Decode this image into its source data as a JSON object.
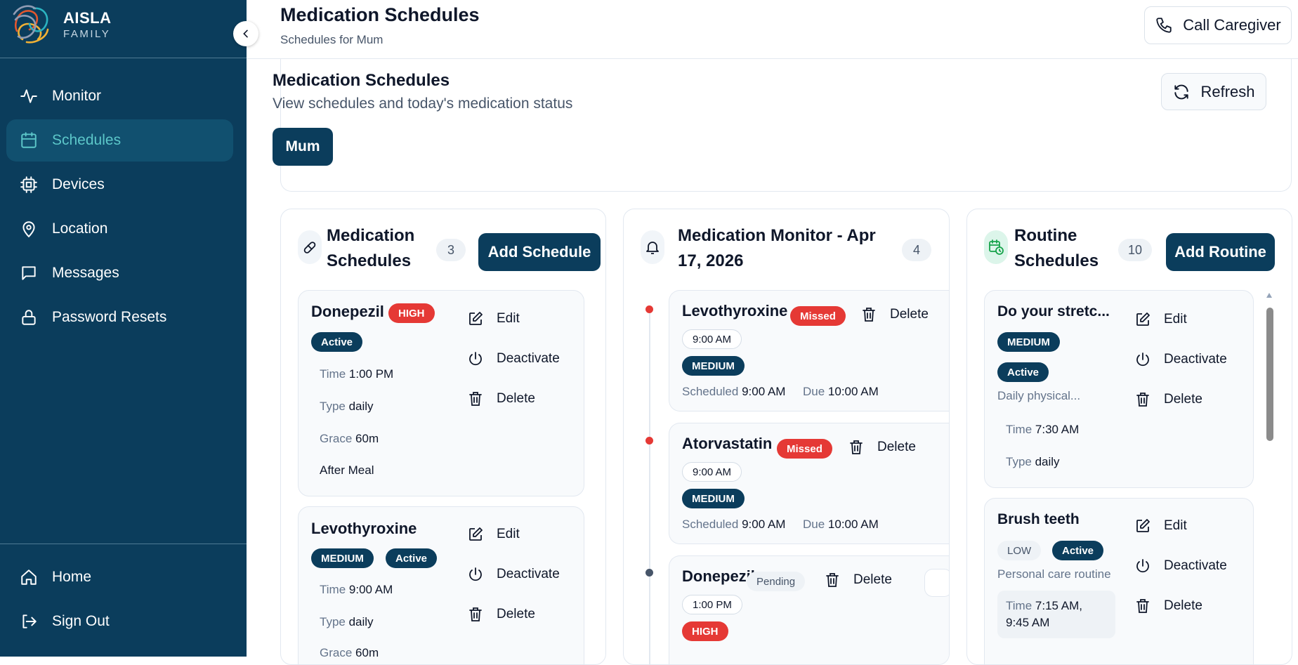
{
  "brand": {
    "name": "AISLA",
    "sub": "FAMILY"
  },
  "nav": [
    {
      "label": "Monitor",
      "icon": "activity-icon"
    },
    {
      "label": "Schedules",
      "icon": "calendar-icon"
    },
    {
      "label": "Devices",
      "icon": "cpu-icon"
    },
    {
      "label": "Location",
      "icon": "map-pin-icon"
    },
    {
      "label": "Messages",
      "icon": "message-icon"
    },
    {
      "label": "Password Resets",
      "icon": "lock-icon"
    }
  ],
  "nav_bottom": [
    {
      "label": "Home",
      "icon": "home-icon"
    },
    {
      "label": "Sign Out",
      "icon": "sign-out-icon"
    }
  ],
  "colors": {
    "sidebar": "#0b3d5c",
    "accent": "#5cc7c9",
    "danger": "#e53935"
  },
  "header": {
    "title": "Medication Schedules",
    "subtitle": "Schedules for Mum",
    "call_label": "Call Caregiver"
  },
  "panel": {
    "title": "Medication Schedules",
    "subtitle": "View schedules and today's medication status",
    "person": "Mum",
    "refresh_label": "Refresh"
  },
  "med": {
    "title_1": "Medication",
    "title_2": "Schedules",
    "count": "3",
    "add_label": "Add Schedule",
    "cards": [
      {
        "name": "Donepezil",
        "priority": "HIGH",
        "status": "Active",
        "time_label": "Time",
        "time": "1:00 PM",
        "type_label": "Type",
        "type": "daily",
        "grace_label": "Grace",
        "grace": "60m",
        "note": "After Meal"
      },
      {
        "name": "Levothyroxine",
        "priority": "MEDIUM",
        "status": "Active",
        "time_label": "Time",
        "time": "9:00 AM",
        "type_label": "Type",
        "type": "daily",
        "grace_label": "Grace",
        "grace": "60m"
      }
    ]
  },
  "monitor": {
    "title_1": "Medication Monitor - Apr",
    "title_2": "17, 2026",
    "count": "4",
    "items": [
      {
        "name": "Levothyroxine",
        "status": "Missed",
        "time": "9:00 AM",
        "priority": "MEDIUM",
        "scheduled_label": "Scheduled",
        "scheduled": "9:00 AM",
        "due_label": "Due",
        "due": "10:00 AM"
      },
      {
        "name": "Atorvastatin",
        "status": "Missed",
        "time": "9:00 AM",
        "priority": "MEDIUM",
        "scheduled_label": "Scheduled",
        "scheduled": "9:00 AM",
        "due_label": "Due",
        "due": "10:00 AM"
      },
      {
        "name": "Donepezil",
        "status": "Pending",
        "time": "1:00 PM",
        "priority": "HIGH"
      }
    ]
  },
  "routine": {
    "title_1": "Routine",
    "title_2": "Schedules",
    "count": "10",
    "add_label": "Add Routine",
    "cards": [
      {
        "name": "Do your stretc...",
        "priority": "MEDIUM",
        "status": "Active",
        "desc": "Daily physical...",
        "time_label": "Time",
        "time": "7:30 AM",
        "type_label": "Type",
        "type": "daily"
      },
      {
        "name": "Brush teeth",
        "priority": "LOW",
        "status": "Active",
        "desc": "Personal care routine",
        "time_label": "Time",
        "time_1": "7:15 AM,",
        "time_2": "9:45 AM"
      }
    ]
  },
  "actions": {
    "edit": "Edit",
    "deactivate": "Deactivate",
    "delete": "Delete"
  }
}
